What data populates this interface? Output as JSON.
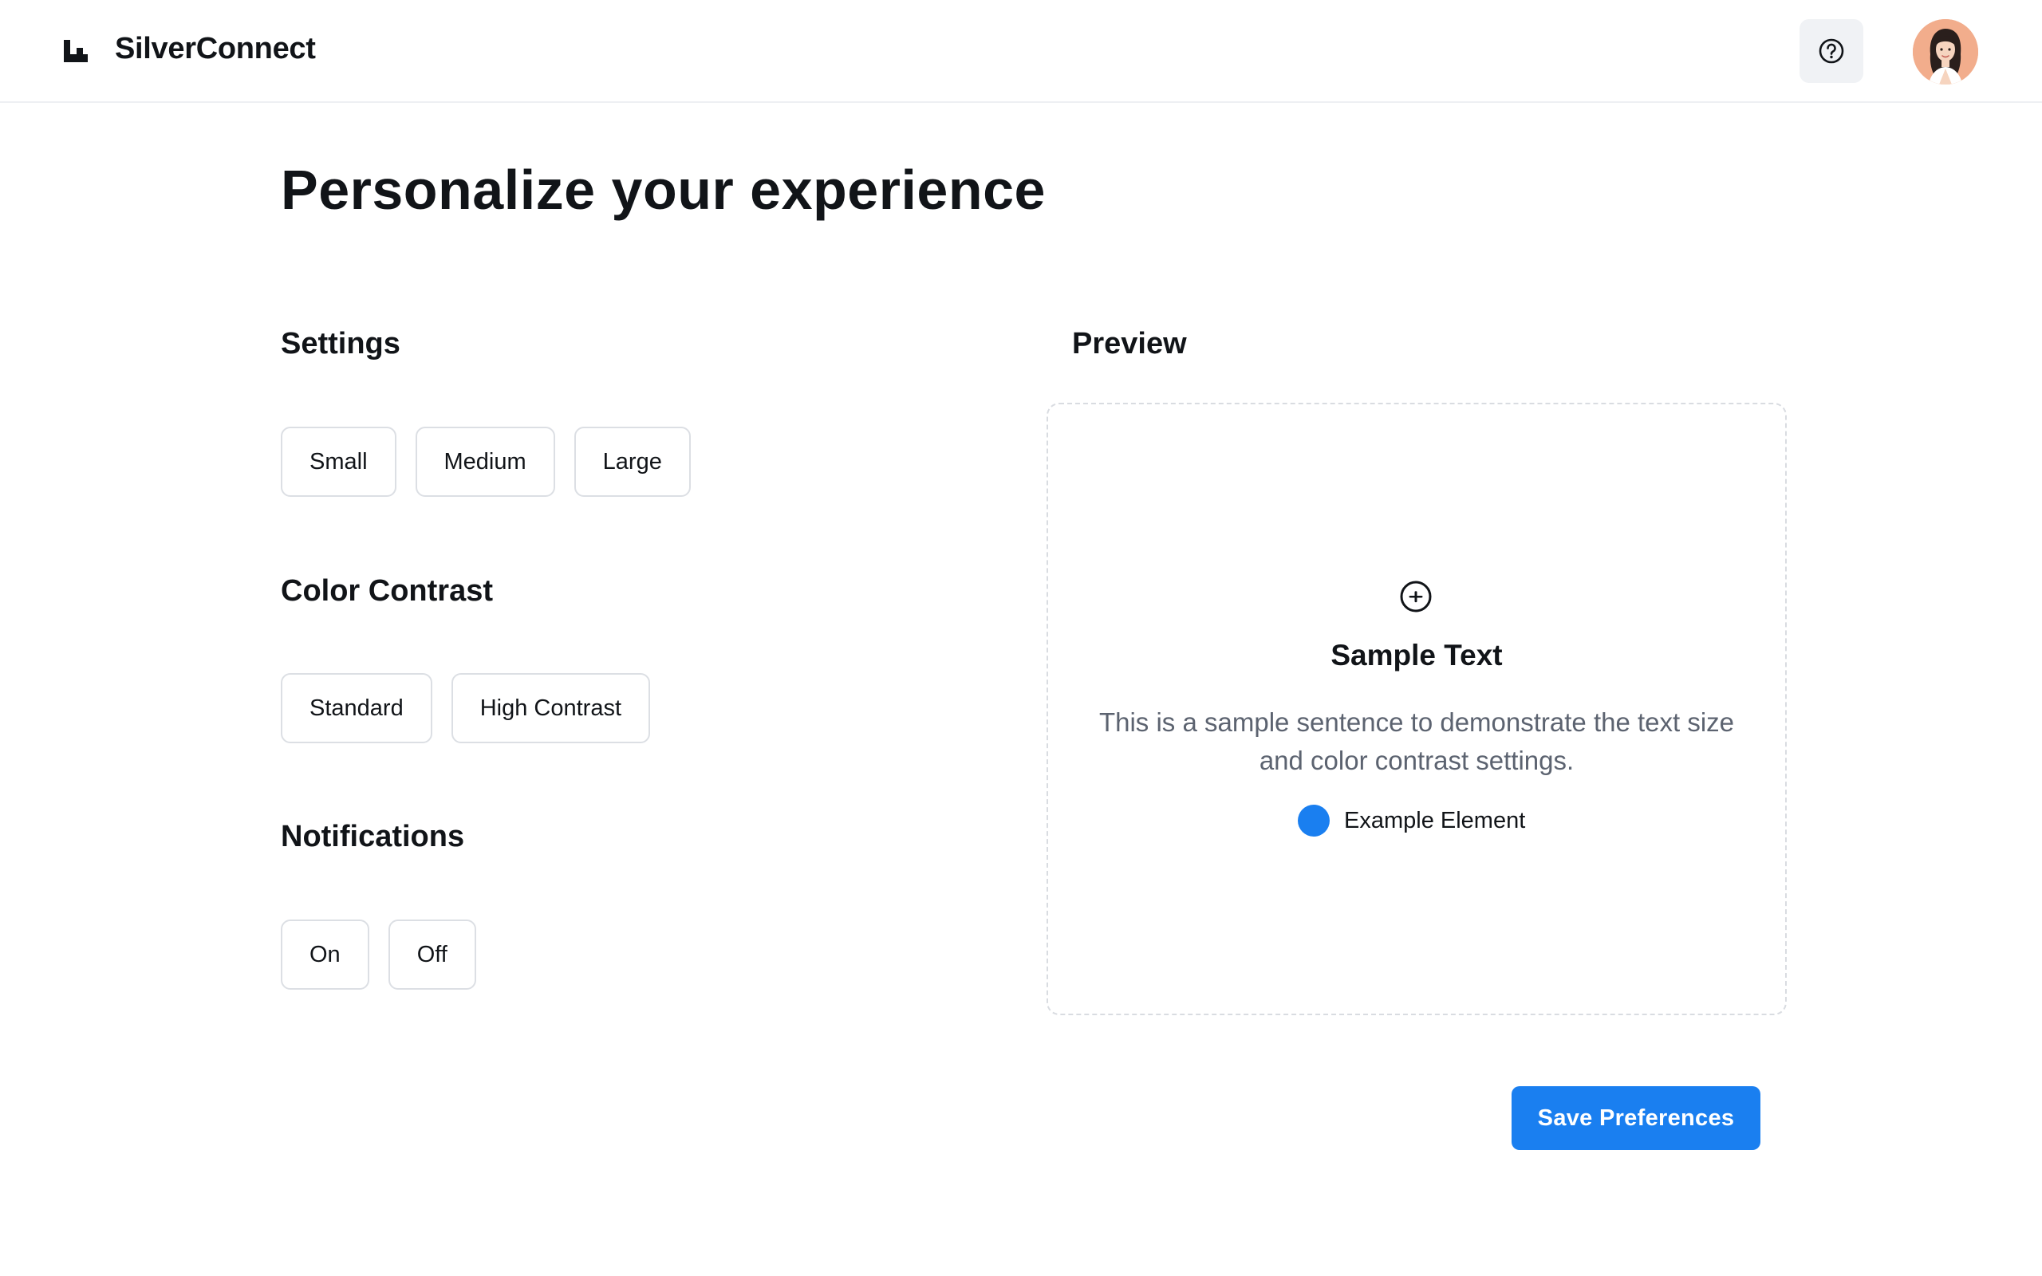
{
  "header": {
    "app_title": "SilverConnect",
    "logo_icon": "stairs-logo-icon",
    "help_icon": "question-circle-icon",
    "avatar_icon": "user-avatar"
  },
  "main": {
    "title": "Personalize your experience",
    "settings": {
      "title": "Settings",
      "options": [
        "Small",
        "Medium",
        "Large"
      ]
    },
    "color_contrast": {
      "title": "Color Contrast",
      "options": [
        "Standard",
        "High Contrast"
      ]
    },
    "notifications": {
      "title": "Notifications",
      "options": [
        "On",
        "Off"
      ]
    },
    "preview": {
      "title": "Preview",
      "icon": "plus-circle-icon",
      "sample_title": "Sample Text",
      "sample_body": "This is a sample sentence to demonstrate the text size and color contrast settings.",
      "example_label": "Example Element",
      "example_color": "#1a7ff0"
    },
    "save_label": "Save Preferences"
  },
  "colors": {
    "accent": "#1a7ff0",
    "text": "#111418",
    "muted_text": "#5c6370",
    "border": "#dcdfe4",
    "avatar_bg": "#f2ad8c"
  }
}
